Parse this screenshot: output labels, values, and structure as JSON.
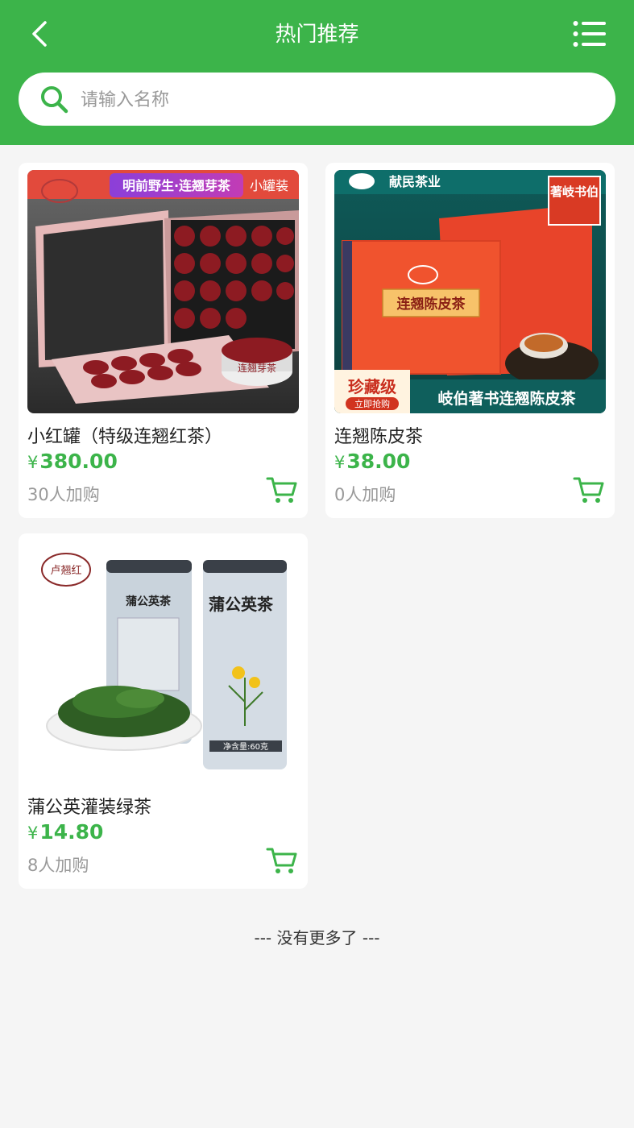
{
  "header": {
    "title": "热门推荐"
  },
  "search": {
    "placeholder": "请输入名称"
  },
  "products": [
    {
      "name": "小红罐（特级连翘红茶）",
      "currency": "¥",
      "price": "380.00",
      "buyers": "30人加购",
      "image": {
        "banner": "明前野生·连翘芽茶",
        "tag": "小罐装",
        "can_label": "连翘芽茶"
      }
    },
    {
      "name": "连翘陈皮茶",
      "currency": "¥",
      "price": "38.00",
      "buyers": "0人加购",
      "image": {
        "brand": "献民茶业",
        "seal": "著岐书伯",
        "box_label": "连翘陈皮茶",
        "badge": "珍藏级",
        "badge_sub": "立即抢购",
        "slogan": "岐伯著书连翘陈皮茶"
      }
    },
    {
      "name": "蒲公英灌装绿茶",
      "currency": "¥",
      "price": "14.80",
      "buyers": "8人加购",
      "image": {
        "logo": "卢翘红",
        "can_left": "蒲公英茶",
        "can_right": "蒲公英茶",
        "net_weight": "净含量:60克"
      }
    }
  ],
  "footer": {
    "no_more": "--- 没有更多了 ---"
  },
  "colors": {
    "brand_green": "#3cb44a"
  }
}
